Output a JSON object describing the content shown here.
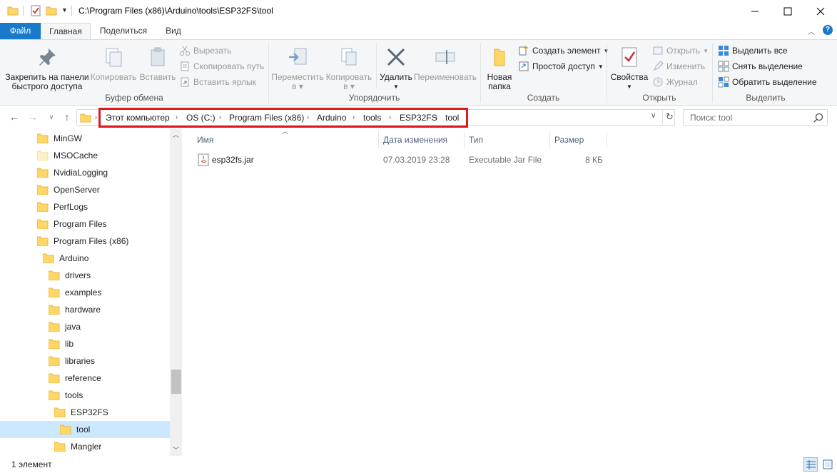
{
  "window": {
    "path": "C:\\Program Files (x86)\\Arduino\\tools\\ESP32FS\\tool"
  },
  "tabs": [
    {
      "label": "Файл"
    },
    {
      "label": "Главная"
    },
    {
      "label": "Поделиться"
    },
    {
      "label": "Вид"
    }
  ],
  "ribbon": {
    "clipboard": {
      "pin_line1": "Закрепить на панели",
      "pin_line2": "быстрого доступа",
      "copy": "Копировать",
      "paste": "Вставить",
      "cut": "Вырезать",
      "copy_path": "Скопировать путь",
      "paste_shortcut": "Вставить ярлык",
      "group": "Буфер обмена"
    },
    "organize": {
      "move_line1": "Переместить",
      "move_line2": "в",
      "copyto_line1": "Копировать",
      "copyto_line2": "в",
      "delete": "Удалить",
      "rename": "Переименовать",
      "group": "Упорядочить"
    },
    "create": {
      "new_folder_line1": "Новая",
      "new_folder_line2": "папка",
      "new_item": "Создать элемент",
      "easy_access": "Простой доступ",
      "group": "Создать"
    },
    "open": {
      "properties": "Свойства",
      "open": "Открыть",
      "edit": "Изменить",
      "history": "Журнал",
      "group": "Открыть"
    },
    "select": {
      "select_all": "Выделить все",
      "select_none": "Снять выделение",
      "invert": "Обратить выделение",
      "group": "Выделить"
    }
  },
  "address": {
    "crumbs": [
      {
        "label": "Этот компьютер"
      },
      {
        "label": "OS (C:)"
      },
      {
        "label": "Program Files (x86)"
      },
      {
        "label": "Arduino"
      },
      {
        "label": "tools"
      },
      {
        "label": "ESP32FS"
      },
      {
        "label": "tool"
      }
    ],
    "search_placeholder": "Поиск: tool"
  },
  "nav": {
    "items": [
      {
        "label": "MinGW"
      },
      {
        "label": "MSOCache"
      },
      {
        "label": "NvidiaLogging"
      },
      {
        "label": "OpenServer"
      },
      {
        "label": "PerfLogs"
      },
      {
        "label": "Program Files"
      },
      {
        "label": "Program Files (x86)"
      },
      {
        "label": "Arduino"
      },
      {
        "label": "drivers"
      },
      {
        "label": "examples"
      },
      {
        "label": "hardware"
      },
      {
        "label": "java"
      },
      {
        "label": "lib"
      },
      {
        "label": "libraries"
      },
      {
        "label": "reference"
      },
      {
        "label": "tools"
      },
      {
        "label": "ESP32FS"
      },
      {
        "label": "tool"
      },
      {
        "label": "Mangler"
      }
    ]
  },
  "files": {
    "columns": [
      {
        "label": "Имя"
      },
      {
        "label": "Дата изменения"
      },
      {
        "label": "Тип"
      },
      {
        "label": "Размер"
      }
    ],
    "rows": [
      {
        "name": "esp32fs.jar",
        "date": "07.03.2019 23:28",
        "type": "Executable Jar File",
        "size": "8 КБ"
      }
    ]
  },
  "status": {
    "count": "1 элемент"
  },
  "colors": {
    "accent": "#1979ca",
    "highlight": "#e0191f",
    "folder": "#ffd766",
    "selection": "#cce8ff"
  }
}
